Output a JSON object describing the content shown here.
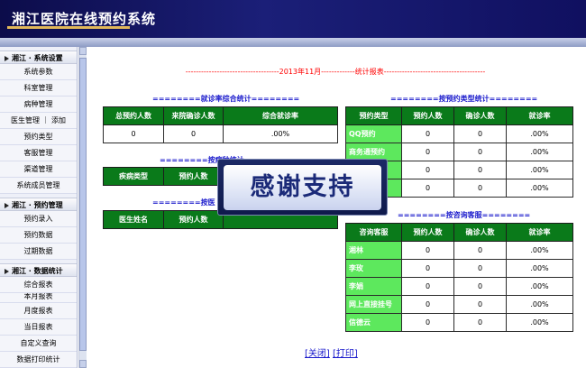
{
  "header": {
    "title": "湘江医院在线预约系统"
  },
  "sidebar": {
    "sections": [
      {
        "label": "湘江 · 系统设置",
        "items": [
          "系统参数",
          "科室管理",
          "病种管理",
          "医生管理 ｜ 添加",
          "预约类型",
          "客服管理",
          "渠道管理",
          "系统成员管理"
        ]
      },
      {
        "label": "湘江 · 预约管理",
        "items": [
          "预约录入",
          "预约数据",
          "过期数据"
        ]
      },
      {
        "label": "湘江 · 数据统计",
        "items": [
          "综合报表",
          "本月报表",
          "月度报表",
          "当日报表",
          "自定义查询",
          "数据打印统计"
        ]
      }
    ]
  },
  "report": {
    "title": "------------------------------------2013年11月-------------统计报表---------------------------------------"
  },
  "summary": {
    "title": "========就诊率综合统计========",
    "headers": [
      "总预约人数",
      "来院确诊人数",
      "综合就诊率"
    ],
    "row": [
      "0",
      "0",
      ".00%"
    ]
  },
  "disease": {
    "title": "========按病种统计",
    "headers": [
      "疾病类型",
      "预约人数"
    ]
  },
  "doctor": {
    "title": "========按医",
    "headers": [
      "医生姓名",
      "预约人数"
    ]
  },
  "type_stats": {
    "title": "========按预约类型统计========",
    "headers": [
      "预约类型",
      "预约人数",
      "确诊人数",
      "就诊率"
    ],
    "rows": [
      [
        "QQ预约",
        "0",
        "0",
        ".00%"
      ],
      [
        "商务通预约",
        "0",
        "0",
        ".00%"
      ],
      [
        "",
        "0",
        "0",
        ".00%"
      ],
      [
        "",
        "0",
        "0",
        ".00%"
      ]
    ]
  },
  "service_stats": {
    "title": "========按咨询客服========",
    "headers": [
      "咨询客服",
      "预约人数",
      "确诊人数",
      "就诊率"
    ],
    "rows": [
      [
        "湘林",
        "0",
        "0",
        ".00%"
      ],
      [
        "李玫",
        "0",
        "0",
        ".00%"
      ],
      [
        "李娟",
        "0",
        "0",
        ".00%"
      ],
      [
        "网上直接挂号",
        "0",
        "0",
        ".00%"
      ],
      [
        "信德云",
        "0",
        "0",
        ".00%"
      ]
    ]
  },
  "overlay": {
    "text": "感谢支持"
  },
  "links": {
    "close": "[关闭]",
    "print": "[打印]"
  }
}
